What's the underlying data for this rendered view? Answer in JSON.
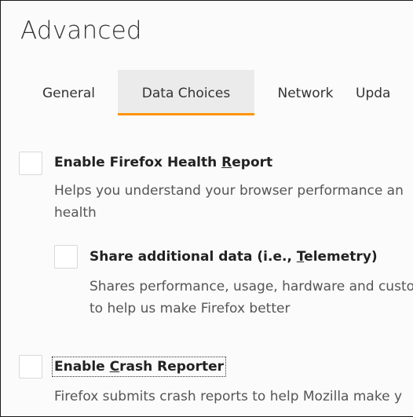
{
  "page": {
    "title": "Advanced"
  },
  "tabs": [
    {
      "label": "General"
    },
    {
      "label": "Data Choices",
      "selected": true
    },
    {
      "label": "Network"
    },
    {
      "label": "Upda"
    }
  ],
  "accent_color": "#ff9400",
  "options": {
    "health_report": {
      "label_before": "Enable Firefox Health ",
      "label_accesskey": "R",
      "label_after": "eport",
      "checked": false,
      "description_line1": "Helps you understand your browser performance an",
      "description_line2": "health"
    },
    "telemetry": {
      "label_before": "Share additional data (i.e., ",
      "label_accesskey": "T",
      "label_after": "elemetry)",
      "checked": false,
      "description_line1": "Shares performance, usage, hardware and custo",
      "description_line2": "to help us make Firefox better"
    },
    "crash_reporter": {
      "label_before": "Enable ",
      "label_accesskey": "C",
      "label_after": "rash Reporter",
      "checked": false,
      "description_line1": "Firefox submits crash reports to help Mozilla make y"
    }
  }
}
